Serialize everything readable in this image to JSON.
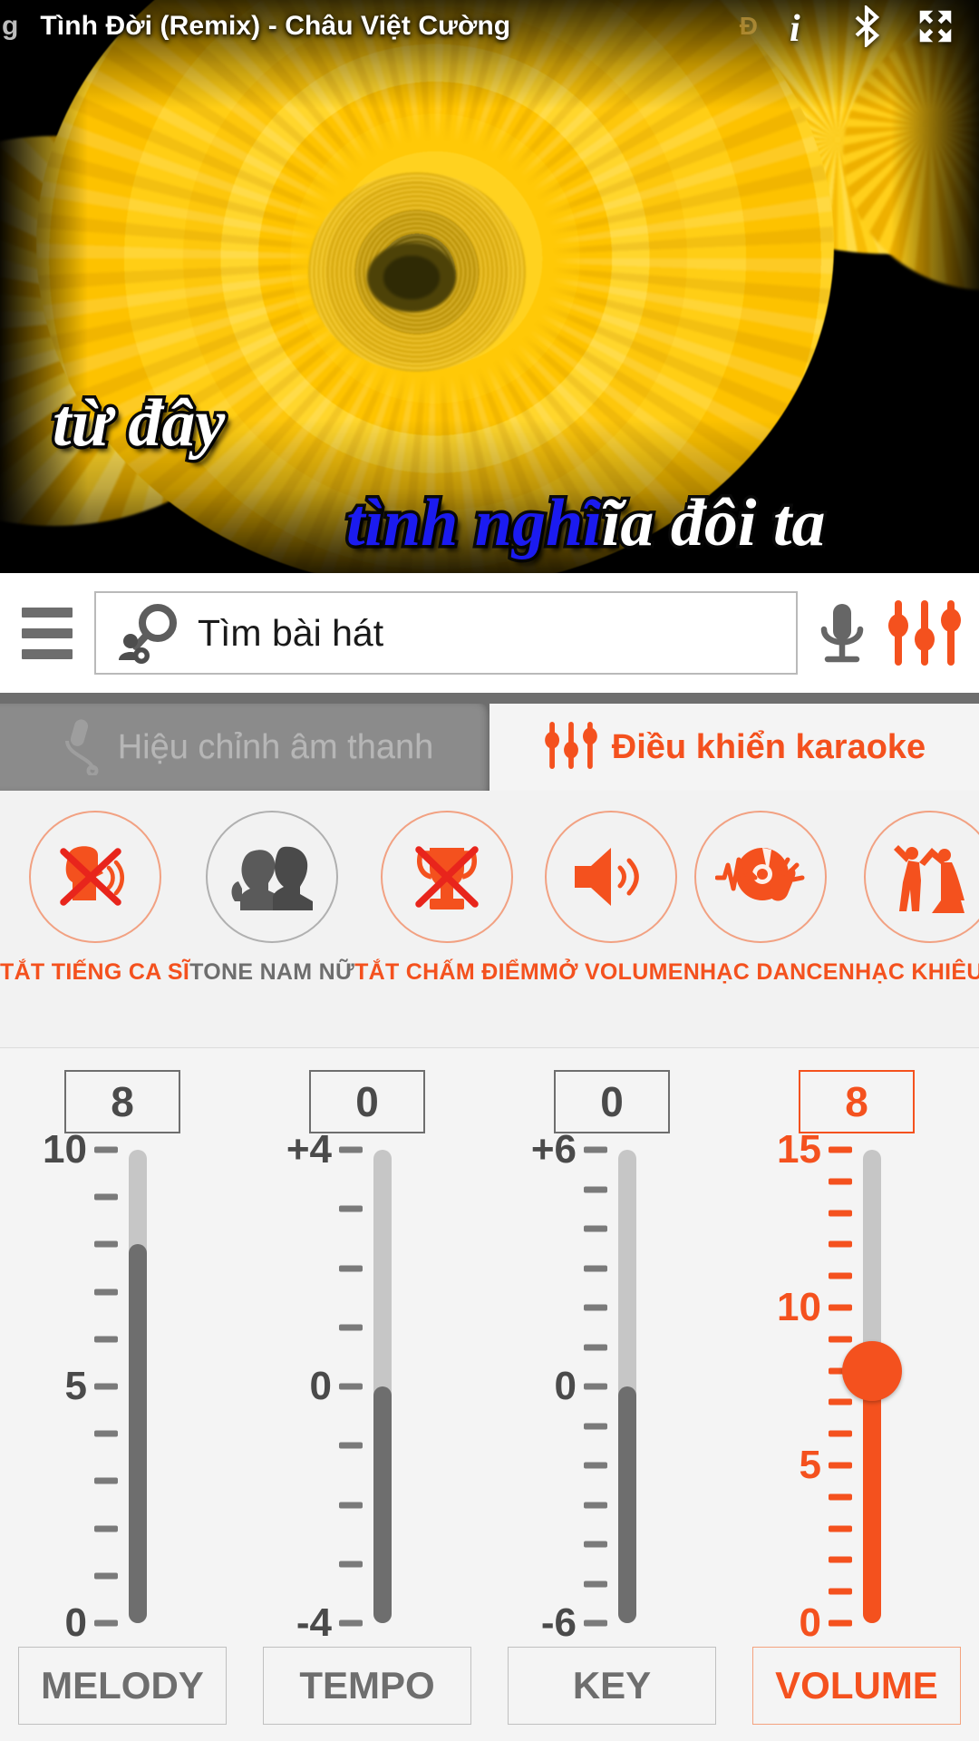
{
  "topbar": {
    "title_prefix": "g",
    "song_title": "Tình Đời (Remix) - Châu Việt Cường",
    "watermark_glyph": "Đ",
    "icons": [
      {
        "name": "info-icon",
        "label": "i"
      },
      {
        "name": "bluetooth-icon",
        "label": "Bluetooth"
      },
      {
        "name": "fullscreen-icon",
        "label": "Fullscreen"
      }
    ]
  },
  "lyrics": {
    "line1": "từ đây",
    "line2_sung": "tình nghĩ",
    "line2_rest": "ĩa đôi ta",
    "line2_full": "tình nghĩa đôi ta"
  },
  "search": {
    "placeholder": "Tìm bài hát",
    "value": "",
    "menu_icon": "hamburger-menu-icon",
    "search_icon": "search-person-icon",
    "mic_icon": "microphone-icon",
    "equalizer_icon": "equalizer-icon"
  },
  "tabs": [
    {
      "label": "Hiệu chỉnh âm thanh",
      "icon": "microphone-icon",
      "active": false
    },
    {
      "label": "Điều khiển karaoke",
      "icon": "equalizer-icon",
      "active": true
    }
  ],
  "features": [
    {
      "label": "TẮT TIẾNG CA SĨ",
      "icon": "singer-mute-icon",
      "active": true
    },
    {
      "label": "TONE NAM NỮ",
      "icon": "male-female-heads-icon",
      "active": false
    },
    {
      "label": "TẮT CHẤM ĐIỂM",
      "icon": "trophy-off-icon",
      "active": true
    },
    {
      "label": "MỞ VOLUME",
      "icon": "speaker-on-icon",
      "active": true
    },
    {
      "label": "NHẠC DANCE",
      "icon": "dance-disc-icon",
      "active": true
    },
    {
      "label": "NHẠC KHIÊU VŨ",
      "icon": "ballroom-dancers-icon",
      "active": true
    }
  ],
  "sliders": [
    {
      "name": "MELODY",
      "value": "8",
      "min": 0,
      "max": 10,
      "current": 8,
      "active": false,
      "labels": [
        {
          "at": 10,
          "text": "10"
        },
        {
          "at": 5,
          "text": "5"
        },
        {
          "at": 0,
          "text": "0"
        }
      ]
    },
    {
      "name": "TEMPO",
      "value": "0",
      "min": -4,
      "max": 4,
      "current": 0,
      "active": false,
      "labels": [
        {
          "at": 4,
          "text": "+4"
        },
        {
          "at": 0,
          "text": "0"
        },
        {
          "at": -4,
          "text": "-4"
        }
      ]
    },
    {
      "name": "KEY",
      "value": "0",
      "min": -6,
      "max": 6,
      "current": 0,
      "active": false,
      "labels": [
        {
          "at": 6,
          "text": "+6"
        },
        {
          "at": 0,
          "text": "0"
        },
        {
          "at": -6,
          "text": "-6"
        }
      ]
    },
    {
      "name": "VOLUME",
      "value": "8",
      "min": 0,
      "max": 15,
      "current": 8,
      "active": true,
      "labels": [
        {
          "at": 15,
          "text": "15"
        },
        {
          "at": 10,
          "text": "10"
        },
        {
          "at": 5,
          "text": "5"
        },
        {
          "at": 0,
          "text": "0"
        }
      ]
    }
  ],
  "colors": {
    "accent": "#f4511e",
    "gray_text": "#6e6e6e",
    "track": "#c6c6c6",
    "fill": "#6e6e6e",
    "lyric_sung": "#1b1bf0",
    "lyric_rest": "#ffffff"
  }
}
